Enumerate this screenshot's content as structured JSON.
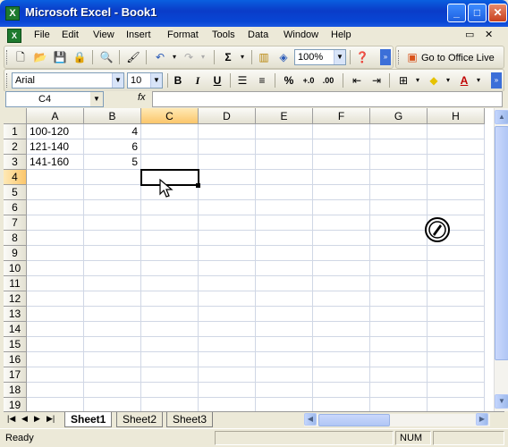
{
  "window": {
    "title": "Microsoft Excel - Book1",
    "app_icon_letter": "X",
    "minimize": "_",
    "maximize": "□",
    "close": "✕"
  },
  "menu": {
    "items": [
      "File",
      "Edit",
      "View",
      "Insert",
      "Format",
      "Tools",
      "Data",
      "Window",
      "Help"
    ],
    "restore_glyph": "▭",
    "close_glyph": "✕"
  },
  "standard_toolbar": {
    "zoom": "100%",
    "go_to_office_live": "Go to Office Live",
    "autosum": "Σ"
  },
  "formatting_toolbar": {
    "font": "Arial",
    "font_size": "10",
    "bold": "B",
    "italic": "I",
    "underline": "U",
    "percent": "%",
    "font_color_letter": "A"
  },
  "formula_bar": {
    "name_box": "C4",
    "fx": "fx",
    "value": ""
  },
  "grid": {
    "columns": [
      "A",
      "B",
      "C",
      "D",
      "E",
      "F",
      "G",
      "H"
    ],
    "rows": [
      "1",
      "2",
      "3",
      "4",
      "5",
      "6",
      "7",
      "8",
      "9",
      "10",
      "11",
      "12",
      "13",
      "14",
      "15",
      "16",
      "17",
      "18",
      "19"
    ],
    "active_cell": "C4",
    "cells": {
      "A1": "100-120",
      "B1": "4",
      "A2": "121-140",
      "B2": "6",
      "A3": "141-160",
      "B3": "5"
    }
  },
  "sheets": {
    "tabs": [
      "Sheet1",
      "Sheet2",
      "Sheet3"
    ],
    "active": "Sheet1"
  },
  "status": {
    "left": "Ready",
    "num": "NUM"
  },
  "colors": {
    "title_bar": "#0A3CC8",
    "active_header": "#FBC66B",
    "grid_line": "#D0D7E5"
  }
}
